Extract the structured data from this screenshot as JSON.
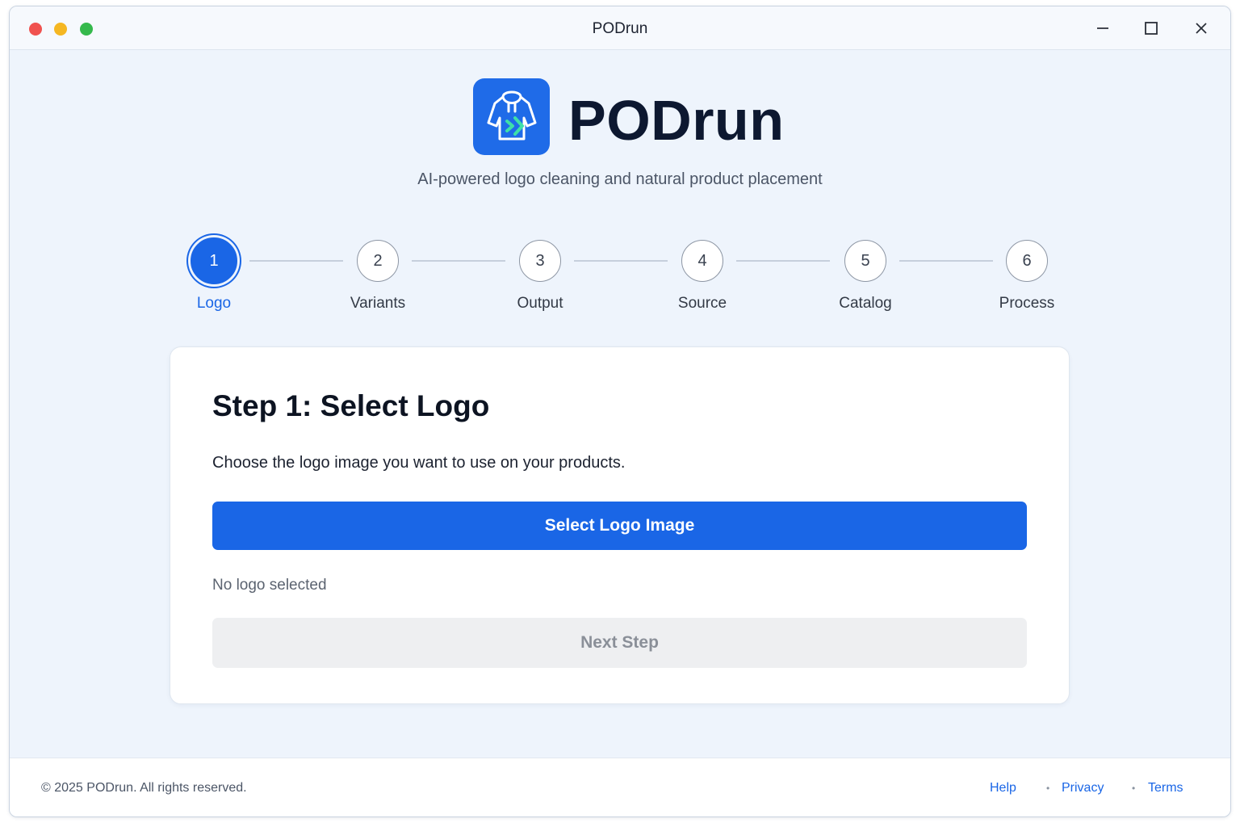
{
  "window": {
    "title": "PODrun"
  },
  "brand": {
    "name": "PODrun",
    "tagline": "AI-powered logo cleaning and natural product placement",
    "logo_icon": "hoodie-arrow-icon",
    "accent_color": "#1a66e6"
  },
  "stepper": {
    "active_step": 1,
    "steps": [
      {
        "number": "1",
        "label": "Logo"
      },
      {
        "number": "2",
        "label": "Variants"
      },
      {
        "number": "3",
        "label": "Output"
      },
      {
        "number": "4",
        "label": "Source"
      },
      {
        "number": "5",
        "label": "Catalog"
      },
      {
        "number": "6",
        "label": "Process"
      }
    ]
  },
  "card": {
    "title": "Step 1: Select Logo",
    "description": "Choose the logo image you want to use on your products.",
    "select_button": "Select Logo Image",
    "status": "No logo selected",
    "next_button": "Next Step",
    "next_enabled": false
  },
  "footer": {
    "copyright": "© 2025 PODrun. All rights reserved.",
    "links": [
      "Help",
      "Privacy",
      "Terms"
    ]
  }
}
